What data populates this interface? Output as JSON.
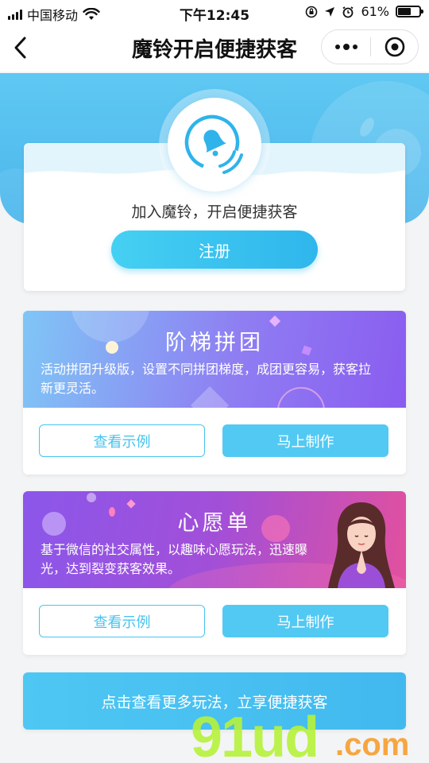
{
  "status_bar": {
    "carrier": "中国移动",
    "time": "下午12:45",
    "battery_percent": "61%",
    "battery_level": 0.61
  },
  "nav": {
    "title": "魔铃开启便捷获客"
  },
  "register": {
    "tagline": "加入魔铃，开启便捷获客",
    "button": "注册"
  },
  "features": [
    {
      "title": "阶梯拼团",
      "description": "活动拼团升级版，设置不同拼团梯度，成团更容易，获客拉新更灵活。",
      "example_button": "查看示例",
      "make_button": "马上制作"
    },
    {
      "title": "心愿单",
      "description": "基于微信的社交属性，以趣味心愿玩法，迅速曝光，达到裂变获客效果。",
      "example_button": "查看示例",
      "make_button": "马上制作"
    }
  ],
  "more_banner": "点击查看更多玩法，立享便捷获客",
  "colors": {
    "accent": "#47c4f0",
    "hero": "#4bb6ec",
    "feature1_gradient_start": "#7fc0f5",
    "feature1_gradient_end": "#8a5cf0",
    "feature2_gradient_start": "#8b55e8",
    "feature2_gradient_end": "#e84f9a"
  }
}
